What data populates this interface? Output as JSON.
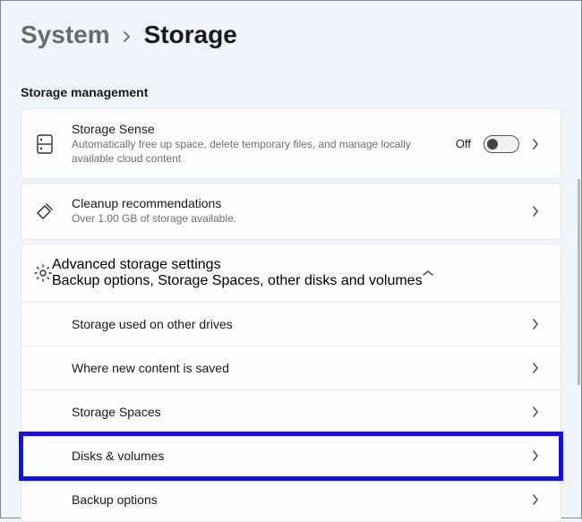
{
  "breadcrumb": {
    "parent": "System",
    "current": "Storage"
  },
  "section_header": "Storage management",
  "storage_sense": {
    "title": "Storage Sense",
    "desc": "Automatically free up space, delete temporary files, and manage locally available cloud content",
    "toggle_label": "Off"
  },
  "cleanup": {
    "title": "Cleanup recommendations",
    "desc": "Over 1.00 GB of storage available."
  },
  "advanced": {
    "title": "Advanced storage settings",
    "desc": "Backup options, Storage Spaces, other disks and volumes",
    "items": [
      {
        "label": "Storage used on other drives"
      },
      {
        "label": "Where new content is saved"
      },
      {
        "label": "Storage Spaces"
      },
      {
        "label": "Disks & volumes"
      },
      {
        "label": "Backup options"
      }
    ]
  }
}
